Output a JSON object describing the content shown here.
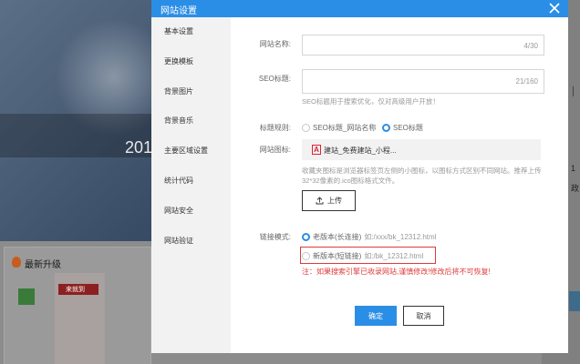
{
  "background": {
    "hero_text": "201",
    "upgrade_title": "最新升级",
    "promo_text": "来就到",
    "right_chars": [
      "│",
      "1",
      "政"
    ]
  },
  "modal": {
    "title": "网站设置",
    "close_icon": "close-icon",
    "sidebar": [
      {
        "label": "基本设置"
      },
      {
        "label": "更换模板"
      },
      {
        "label": "背景图片"
      },
      {
        "label": "背景音乐"
      },
      {
        "label": "主要区域设置"
      },
      {
        "label": "统计代码"
      },
      {
        "label": "网站安全"
      },
      {
        "label": "网站验证"
      }
    ],
    "form": {
      "site_name": {
        "label": "网站名称:",
        "value": "",
        "counter": "4/30"
      },
      "seo_title": {
        "label": "SEO标题:",
        "value": "",
        "counter": "21/160",
        "hint": "SEO标题用于搜索优化，仅对高级用户开放！"
      },
      "title_rule": {
        "label": "标题规则:",
        "options": [
          {
            "label": "SEO标题_网站名称",
            "selected": false
          },
          {
            "label": "SEO标题",
            "selected": true
          }
        ]
      },
      "site_icon": {
        "label": "网站图标:",
        "icon_letter": "A",
        "icon_name": "建站_免费建站_小程...",
        "hint": "收藏夹图标是浏览器标签页左侧的小图标，以图标方式区别不同网站。推荐上传32*32像素的.ico图标格式文件。",
        "upload_label": "上传"
      },
      "link_mode": {
        "label": "链接模式:",
        "options": [
          {
            "label": "老版本(长连接)",
            "example": "如:/xxx/bk_12312.html",
            "selected": true
          },
          {
            "label": "新版本(短链接)",
            "example": "如:/bk_12312.html",
            "selected": false
          }
        ],
        "warning": "注：如果搜索引擎已收录网站,谨慎修改!修改后将不可恢复!"
      }
    },
    "buttons": {
      "confirm": "确定",
      "cancel": "取消"
    }
  }
}
